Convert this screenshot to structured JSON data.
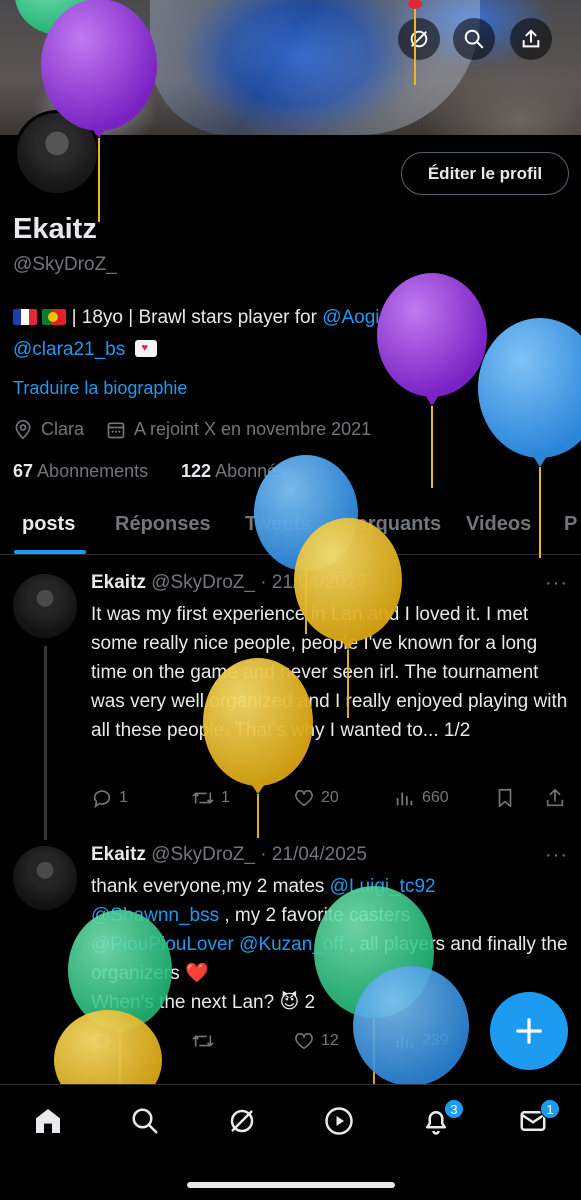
{
  "profile": {
    "edit_label": "Éditer le profil",
    "name": "Ekaitz",
    "handle": "@SkyDroZ_",
    "bio_text1": "| 18yo | Brawl stars player for ",
    "bio_mention1": "@AogiriEsport_",
    "bio_sep": " |",
    "bio_mention2": "@clara21_bs",
    "translate": "Traduire la biographie",
    "location": "Clara",
    "joined": "A rejoint X en novembre 2021",
    "following_count": "67",
    "following_label": "Abonnements",
    "followers_count": "122",
    "followers_label": "Abonnés"
  },
  "tabs": [
    "posts",
    "Réponses",
    "Tweets",
    "Marquants",
    "Videos",
    "P"
  ],
  "tweets": [
    {
      "name": "Ekaitz",
      "handle": "@SkyDroZ_",
      "date": "· 21/04/2025",
      "text": "It was my first experience in Lan and I loved it. I met some really nice people, people I've known for a long time on the game and never seen irl. The tournament was very well organized and I really enjoyed playing with all these people. That's why I wanted to... 1/2",
      "replies": "1",
      "retweets": "1",
      "likes": "20",
      "views": "660"
    },
    {
      "name": "Ekaitz",
      "handle": "@SkyDroZ_",
      "date": "· 21/04/2025",
      "text_a": "thank everyone,my 2 mates ",
      "m1": "@Luigi_tc92",
      "m2": "@Shawnn_bss",
      "text_b": " , my 2 favorite casters",
      "m3": "@PiouPiouLover",
      "m4": "@Kuzan_off",
      "text_c": " , all players and finally the organizers ❤️",
      "text_d": "When's the next Lan? 😈 2",
      "replies": "",
      "retweets": "",
      "likes": "12",
      "views": "239"
    }
  ],
  "nav": {
    "notifications_badge": "3",
    "messages_badge": "1"
  },
  "colors": {
    "accent": "#1d9bf0",
    "muted": "#71767b",
    "text": "#e7e9ea",
    "balloon_purple": "#8e34d6",
    "balloon_blue": "#3596e6",
    "balloon_yellow": "#e8b820",
    "balloon_green": "#2bd08a"
  }
}
